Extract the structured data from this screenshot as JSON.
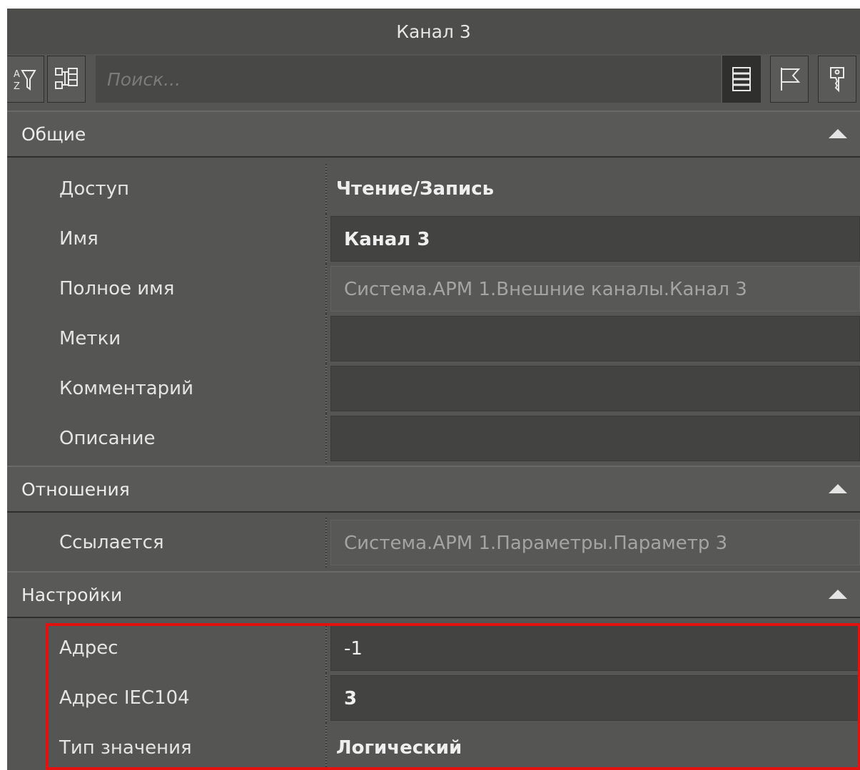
{
  "window": {
    "title": "Канал 3"
  },
  "toolbar": {
    "sort_icon": "sort-alpha-filter-icon",
    "categorize_icon": "categorize-icon",
    "search_placeholder": "Поиск...",
    "list_view_icon": "list-view-icon",
    "flag_icon": "flag-icon",
    "key_icon": "key-icon"
  },
  "sections": {
    "general": {
      "title": "Общие",
      "rows": [
        {
          "label": "Доступ",
          "value": "Чтение/Запись"
        },
        {
          "label": "Имя",
          "value": "Канал 3"
        },
        {
          "label": "Полное имя",
          "value": "Система.АРМ 1.Внешние каналы.Канал 3"
        },
        {
          "label": "Метки",
          "value": ""
        },
        {
          "label": "Комментарий",
          "value": ""
        },
        {
          "label": "Описание",
          "value": ""
        }
      ]
    },
    "relations": {
      "title": "Отношения",
      "rows": [
        {
          "label": "Ссылается",
          "value": "Система.АРМ 1.Параметры.Параметр 3"
        }
      ]
    },
    "settings": {
      "title": "Настройки",
      "rows": [
        {
          "label": "Адрес",
          "value": "-1"
        },
        {
          "label": "Адрес IEC104",
          "value": "3"
        },
        {
          "label": "Тип значения",
          "value": "Логический"
        }
      ]
    }
  },
  "colors": {
    "panel_bg": "#555553",
    "field_bg": "#434342",
    "highlight": "#e3120f"
  }
}
